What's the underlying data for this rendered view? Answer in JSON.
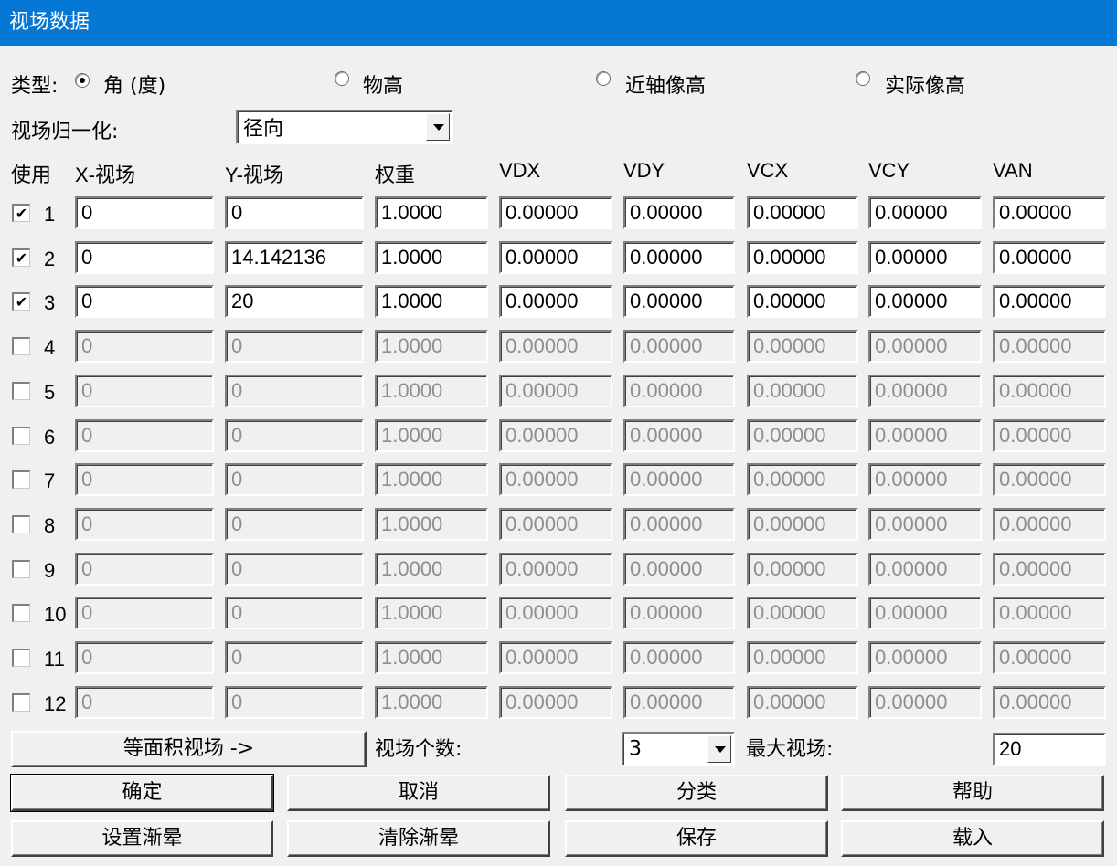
{
  "window": {
    "title": "视场数据"
  },
  "type_row": {
    "label": "类型:",
    "options": [
      {
        "label": "角 (度)",
        "selected": true
      },
      {
        "label": "物高",
        "selected": false
      },
      {
        "label": "近轴像高",
        "selected": false
      },
      {
        "label": "实际像高",
        "selected": false
      }
    ]
  },
  "normalization": {
    "label": "视场归一化:",
    "value": "径向"
  },
  "table": {
    "headers": [
      "使用",
      "X-视场",
      "Y-视场",
      "权重",
      "VDX",
      "VDY",
      "VCX",
      "VCY",
      "VAN"
    ],
    "rows": [
      {
        "num": "1",
        "checked": true,
        "checkmark": "✔",
        "x": "0",
        "y": "0",
        "w": "1.0000",
        "vdx": "0.00000",
        "vdy": "0.00000",
        "vcx": "0.00000",
        "vcy": "0.00000",
        "van": "0.00000"
      },
      {
        "num": "2",
        "checked": true,
        "checkmark": "✔",
        "x": "0",
        "y": "14.142136",
        "w": "1.0000",
        "vdx": "0.00000",
        "vdy": "0.00000",
        "vcx": "0.00000",
        "vcy": "0.00000",
        "van": "0.00000"
      },
      {
        "num": "3",
        "checked": true,
        "checkmark": "✔",
        "x": "0",
        "y": "20",
        "w": "1.0000",
        "vdx": "0.00000",
        "vdy": "0.00000",
        "vcx": "0.00000",
        "vcy": "0.00000",
        "van": "0.00000"
      },
      {
        "num": "4",
        "checked": false,
        "checkmark": "",
        "x": "0",
        "y": "0",
        "w": "1.0000",
        "vdx": "0.00000",
        "vdy": "0.00000",
        "vcx": "0.00000",
        "vcy": "0.00000",
        "van": "0.00000"
      },
      {
        "num": "5",
        "checked": false,
        "checkmark": "",
        "x": "0",
        "y": "0",
        "w": "1.0000",
        "vdx": "0.00000",
        "vdy": "0.00000",
        "vcx": "0.00000",
        "vcy": "0.00000",
        "van": "0.00000"
      },
      {
        "num": "6",
        "checked": false,
        "checkmark": "",
        "x": "0",
        "y": "0",
        "w": "1.0000",
        "vdx": "0.00000",
        "vdy": "0.00000",
        "vcx": "0.00000",
        "vcy": "0.00000",
        "van": "0.00000"
      },
      {
        "num": "7",
        "checked": false,
        "checkmark": "",
        "x": "0",
        "y": "0",
        "w": "1.0000",
        "vdx": "0.00000",
        "vdy": "0.00000",
        "vcx": "0.00000",
        "vcy": "0.00000",
        "van": "0.00000"
      },
      {
        "num": "8",
        "checked": false,
        "checkmark": "",
        "x": "0",
        "y": "0",
        "w": "1.0000",
        "vdx": "0.00000",
        "vdy": "0.00000",
        "vcx": "0.00000",
        "vcy": "0.00000",
        "van": "0.00000"
      },
      {
        "num": "9",
        "checked": false,
        "checkmark": "",
        "x": "0",
        "y": "0",
        "w": "1.0000",
        "vdx": "0.00000",
        "vdy": "0.00000",
        "vcx": "0.00000",
        "vcy": "0.00000",
        "van": "0.00000"
      },
      {
        "num": "10",
        "checked": false,
        "checkmark": "",
        "x": "0",
        "y": "0",
        "w": "1.0000",
        "vdx": "0.00000",
        "vdy": "0.00000",
        "vcx": "0.00000",
        "vcy": "0.00000",
        "van": "0.00000"
      },
      {
        "num": "11",
        "checked": false,
        "checkmark": "",
        "x": "0",
        "y": "0",
        "w": "1.0000",
        "vdx": "0.00000",
        "vdy": "0.00000",
        "vcx": "0.00000",
        "vcy": "0.00000",
        "van": "0.00000"
      },
      {
        "num": "12",
        "checked": false,
        "checkmark": "",
        "x": "0",
        "y": "0",
        "w": "1.0000",
        "vdx": "0.00000",
        "vdy": "0.00000",
        "vcx": "0.00000",
        "vcy": "0.00000",
        "van": "0.00000"
      }
    ]
  },
  "equal_area_button": "等面积视场 ->",
  "field_count": {
    "label": "视场个数:",
    "value": "3"
  },
  "max_field": {
    "label": "最大视场:",
    "value": "20"
  },
  "buttons": {
    "ok": "确定",
    "cancel": "取消",
    "sort": "分类",
    "help": "帮助",
    "set_vignetting": "设置渐晕",
    "clear_vignetting": "清除渐晕",
    "save": "保存",
    "load": "载入"
  },
  "icons": {
    "dropdown_arrow": "chevron-down-icon",
    "checkmark": "check-icon",
    "radio_dot": "radio-dot-icon"
  }
}
